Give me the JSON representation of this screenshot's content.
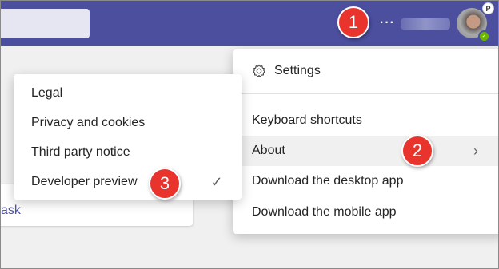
{
  "header": {
    "more_options_glyph": "···",
    "avatar_badge": "P"
  },
  "callouts": [
    "1",
    "2",
    "3"
  ],
  "background": {
    "card_link_fragment": "ask"
  },
  "settings_menu": {
    "settings_label": "Settings",
    "items": [
      {
        "label": "Keyboard shortcuts"
      },
      {
        "label": "About"
      },
      {
        "label": "Download the desktop app"
      },
      {
        "label": "Download the mobile app"
      }
    ],
    "chevron_glyph": "〉"
  },
  "about_submenu": {
    "items": [
      {
        "label": "Legal"
      },
      {
        "label": "Privacy and cookies"
      },
      {
        "label": "Third party notice"
      },
      {
        "label": "Developer preview"
      }
    ],
    "checkmark_glyph": "✓"
  },
  "colors": {
    "header_bg": "#4b4f9e",
    "callout_bg": "#e8342c",
    "hover_bg": "#f0f0f0"
  }
}
